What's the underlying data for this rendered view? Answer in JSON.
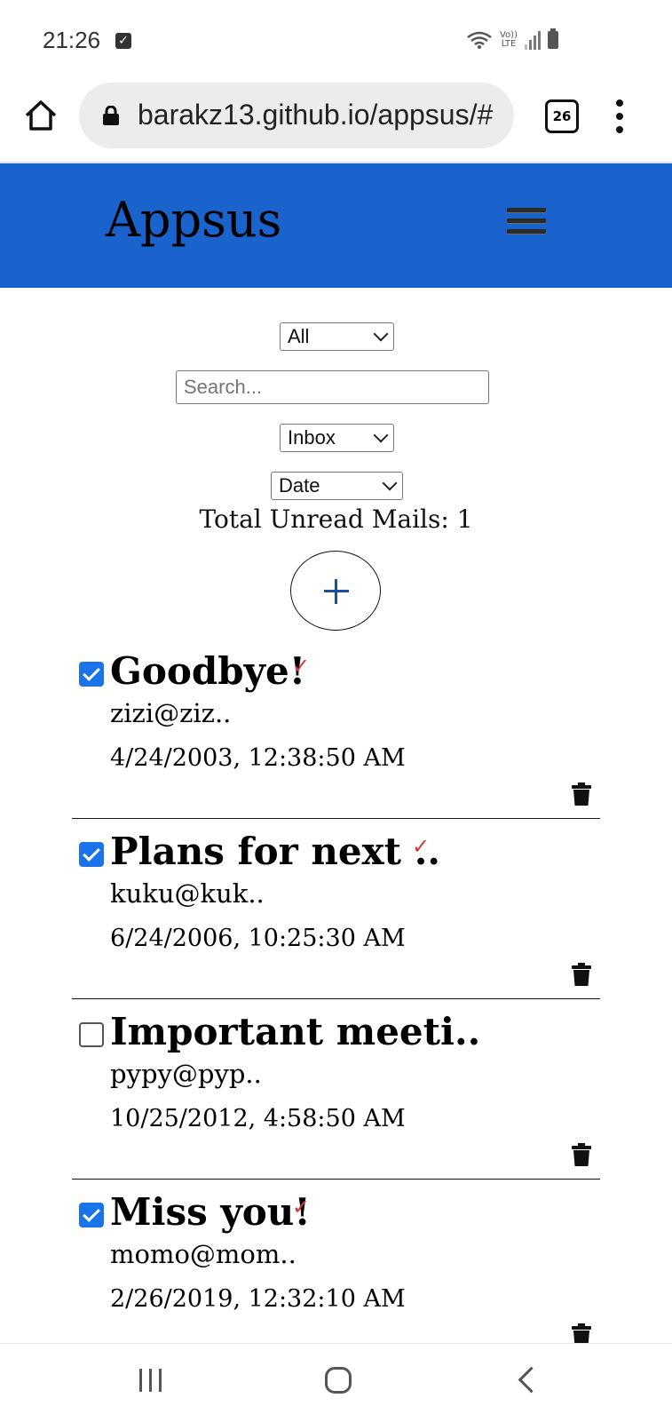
{
  "status_bar": {
    "time": "21:26",
    "network_label": "VoLTE LTE"
  },
  "browser": {
    "url": "barakz13.github.io/appsus/#",
    "tab_count": "26"
  },
  "app": {
    "title": "Appsus"
  },
  "filters": {
    "read_filter": "All",
    "search_placeholder": "Search...",
    "folder": "Inbox",
    "sort": "Date"
  },
  "unread_summary": "Total Unread Mails: 1",
  "mails": [
    {
      "subject": "Goodbye!",
      "from": "zizi@ziz..",
      "date": "4/24/2003, 12:38:50 AM",
      "checked": true,
      "read_mark": "✓"
    },
    {
      "subject": "Plans for next ..",
      "from": "kuku@kuk..",
      "date": "6/24/2006, 10:25:30 AM",
      "checked": true,
      "read_mark": "✓"
    },
    {
      "subject": "Important meeti..",
      "from": "pypy@pyp..",
      "date": "10/25/2012, 4:58:50 AM",
      "checked": false,
      "read_mark": ""
    },
    {
      "subject": "Miss you!",
      "from": "momo@mom..",
      "date": "2/26/2019, 12:32:10 AM",
      "checked": true,
      "read_mark": "✓"
    }
  ],
  "colors": {
    "header": "#1a62cc",
    "checkbox": "#1a73e8",
    "read_mark": "#d23b3b",
    "compose_plus": "#1a4fa3"
  }
}
